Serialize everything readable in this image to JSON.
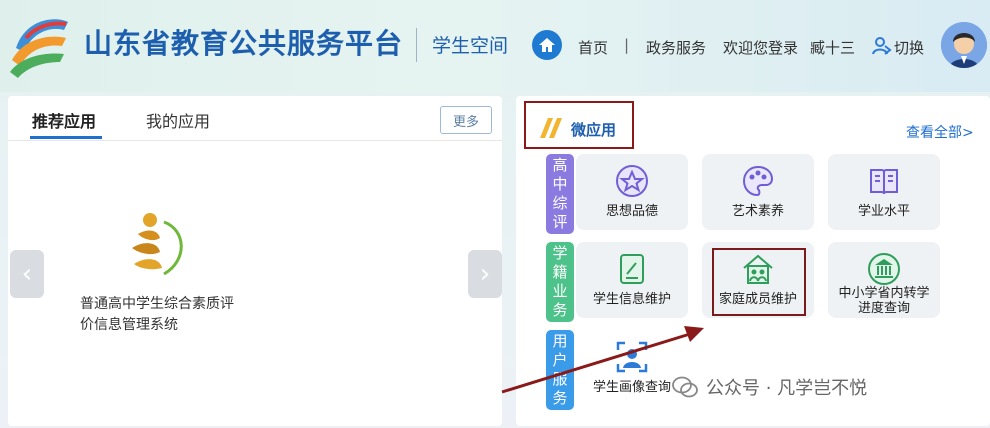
{
  "header": {
    "site_title": "山东省教育公共服务平台",
    "space_name": "学生空间",
    "nav": {
      "home": "首页",
      "sep": "|",
      "gov": "政务服务",
      "welcome": "欢迎您登录",
      "user": "臧十三",
      "switch": "切换"
    }
  },
  "left": {
    "tabs": [
      "推荐应用",
      "我的应用"
    ],
    "more": "更多",
    "prev": "‹",
    "next": "›",
    "app_name": "普通高中学生综合素质评价信息管理系统"
  },
  "right": {
    "title": "微应用",
    "view_all": "查看全部>",
    "categories": [
      {
        "label": [
          "高",
          "中",
          "综",
          "评"
        ]
      },
      {
        "label": [
          "学",
          "籍",
          "业",
          "务"
        ]
      },
      {
        "label": [
          "用",
          "户",
          "服",
          "务"
        ]
      }
    ],
    "apps": [
      {
        "name": "思想品德"
      },
      {
        "name": "艺术素养"
      },
      {
        "name": "学业水平"
      },
      {
        "name": "学生信息维护"
      },
      {
        "name": "家庭成员维护"
      },
      {
        "name": "中小学省内转学进度查询"
      },
      {
        "name": "学生画像查询"
      }
    ]
  },
  "watermark": {
    "text": "公众号 · 凡学岂不悦"
  },
  "colors": {
    "brand": "#1d5fae",
    "accent": "#1f6fcf",
    "highlight": "#8a1a1a"
  }
}
